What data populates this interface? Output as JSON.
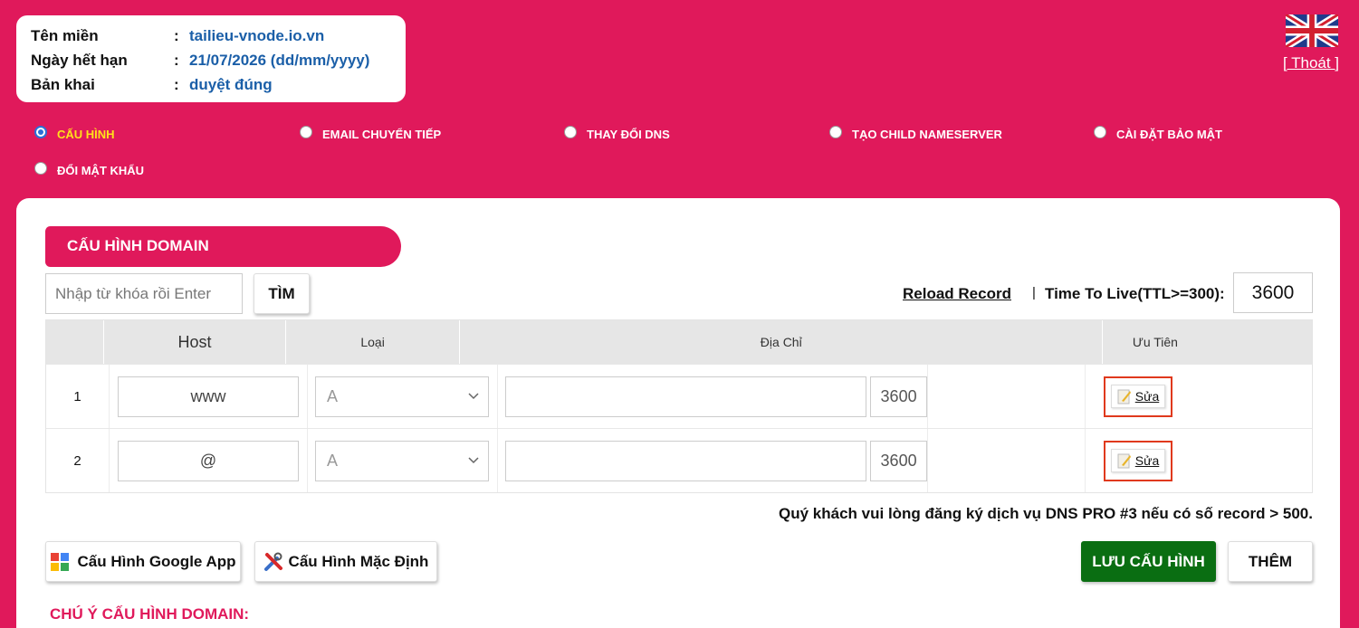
{
  "info": {
    "rows": [
      {
        "label": "Tên miền",
        "colon": ":",
        "value": "tailieu-vnode.io.vn"
      },
      {
        "label": "Ngày hết hạn",
        "colon": ":",
        "value": "21/07/2026 (dd/mm/yyyy)"
      },
      {
        "label": "Bản khai",
        "colon": ":",
        "value": "duyệt đúng"
      }
    ]
  },
  "header": {
    "flag_icon": "uk-flag-icon",
    "logout_label": "[ Thoát ]"
  },
  "nav": {
    "items": [
      {
        "label": "CẤU HÌNH",
        "checked": true
      },
      {
        "label": "EMAIL CHUYỂN TIẾP",
        "checked": false
      },
      {
        "label": "THAY ĐỔI DNS",
        "checked": false
      },
      {
        "label": "TẠO CHILD NAMESERVER",
        "checked": false
      },
      {
        "label": "CÀI ĐẶT BẢO MẬT",
        "checked": false
      },
      {
        "label": "ĐỔI MẬT KHẨU",
        "checked": false
      }
    ]
  },
  "main": {
    "section_title": "CẤU HÌNH DOMAIN",
    "search_placeholder": "Nhập từ khóa rồi Enter",
    "search_button": "TÌM",
    "reload_label": "Reload Record",
    "separator": "|",
    "ttl_label": "Time To Live(TTL>=300):",
    "ttl_value": "3600"
  },
  "table": {
    "headers": [
      "",
      "Host",
      "Loại",
      "Địa Chỉ",
      "Ưu Tiên",
      ""
    ],
    "rows": [
      {
        "index": "1",
        "host": "www",
        "type": "A",
        "address": "",
        "ttl": "3600",
        "edit": "Sửa"
      },
      {
        "index": "2",
        "host": "@",
        "type": "A",
        "address": "",
        "ttl": "3600",
        "edit": "Sửa"
      }
    ]
  },
  "footer": {
    "notice": "Quý khách vui lòng đăng ký dịch vụ DNS PRO #3 nếu có số record > 500.",
    "google_button": "Cấu Hình Google App",
    "default_button": "Cấu Hình Mặc Định",
    "save_button": "LƯU CẤU HÌNH",
    "add_button": "THÊM",
    "note_title": "CHÚ Ý CẤU HÌNH DOMAIN:"
  },
  "colors": {
    "brand": "#e0195b",
    "active_nav": "#ffe11a",
    "link_value": "#1b5fa8",
    "save_green": "#0a6e12",
    "edit_border": "#e0391d"
  }
}
